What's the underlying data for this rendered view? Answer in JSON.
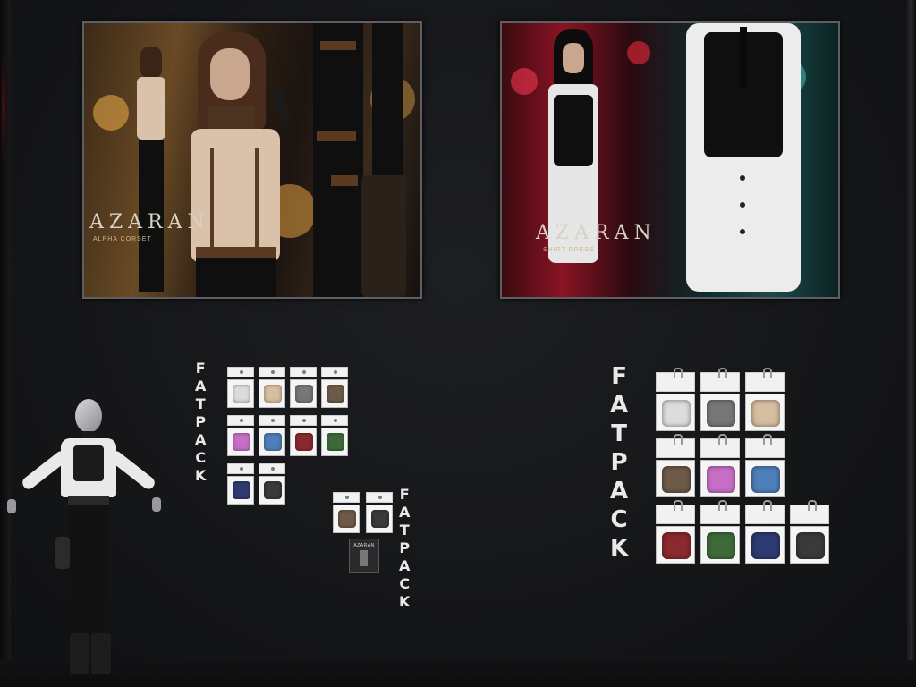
{
  "posters": {
    "left": {
      "brand": "AZARAN",
      "subtitle": "ALPHA CORSET"
    },
    "right": {
      "brand": "AZARAN",
      "subtitle": "SHIRT DRESS"
    }
  },
  "fatpack_labels": {
    "left": "FATPACK",
    "small": "FATPACK",
    "right": "FATPACK"
  },
  "mini_vendor": {
    "label": "AZARAN"
  },
  "colors": {
    "white": "#dcdcdc",
    "tan": "#d6bea0",
    "grey": "#777777",
    "brown": "#6e5a48",
    "pink": "#c66fc6",
    "blue": "#4e7fb8",
    "red": "#8a2a2e",
    "green": "#3e6a3a",
    "navy": "#2e3a72",
    "black": "#3a3a3c"
  },
  "swatches_left": [
    "white",
    "tan",
    "grey",
    "brown",
    "pink",
    "blue",
    "red",
    "green",
    "navy",
    "black"
  ],
  "swatches_small": [
    "brown",
    "black"
  ],
  "swatches_right": [
    "white",
    "grey",
    "tan",
    "brown",
    "pink",
    "blue",
    "red",
    "green",
    "navy",
    "black"
  ]
}
